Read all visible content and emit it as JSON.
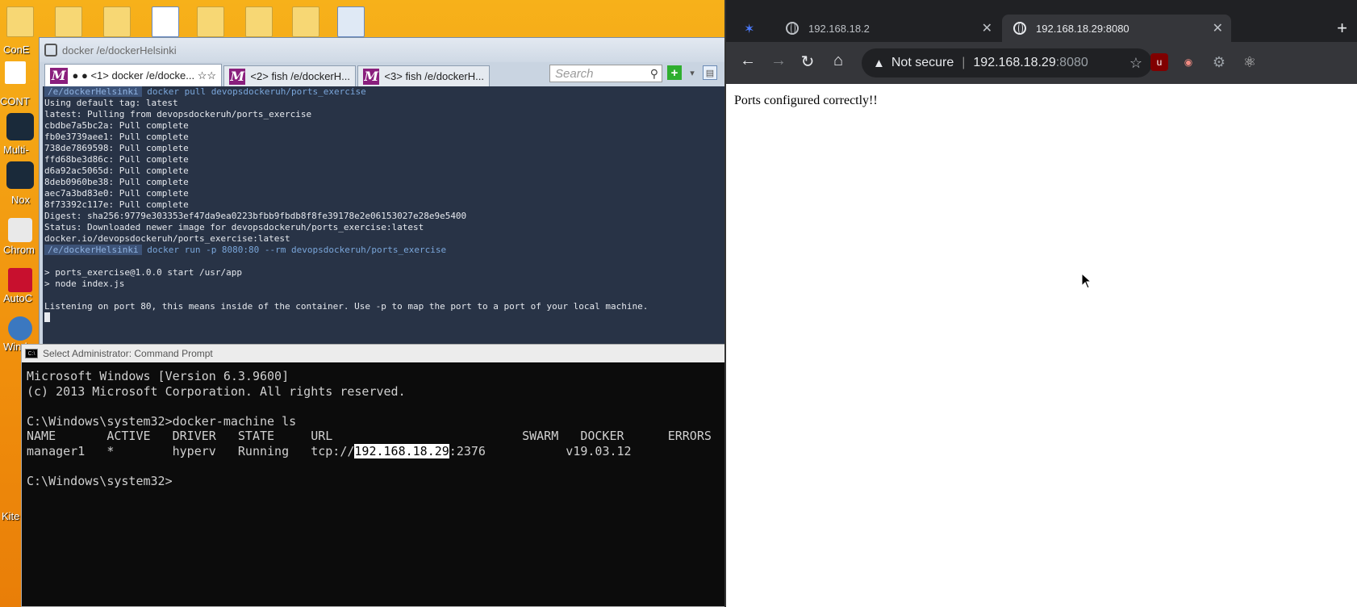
{
  "desktop": {
    "labels": [
      "ConE",
      "CONT",
      "Multi-",
      "Nox",
      "Chrom",
      "AutoC",
      "Windo",
      "Kite"
    ]
  },
  "conemu": {
    "title": "docker /e/dockerHelsinki",
    "tabs": [
      {
        "label": "● ● <1> docker /e/docke... ☆☆"
      },
      {
        "label": "<2> fish /e/dockerH..."
      },
      {
        "label": "<3> fish /e/dockerH..."
      }
    ],
    "search_placeholder": "Search",
    "console": {
      "prompt_path": "/e/dockerHelsinki",
      "cmd1": "docker pull devopsdockeruh/ports_exercise",
      "out1": [
        "Using default tag: latest",
        "latest: Pulling from devopsdockeruh/ports_exercise",
        "cbdbe7a5bc2a: Pull complete",
        "fb0e3739aee1: Pull complete",
        "738de7869598: Pull complete",
        "ffd68be3d86c: Pull complete",
        "d6a92ac5065d: Pull complete",
        "8deb0960be38: Pull complete",
        "aec7a3bd83e0: Pull complete",
        "8f73392c117e: Pull complete",
        "Digest: sha256:9779e303353ef47da9ea0223bfbb9fbdb8f8fe39178e2e06153027e28e9e5400",
        "Status: Downloaded newer image for devopsdockeruh/ports_exercise:latest",
        "docker.io/devopsdockeruh/ports_exercise:latest"
      ],
      "cmd2": "docker run -p 8080:80 --rm devopsdockeruh/ports_exercise",
      "out2": [
        "",
        "> ports_exercise@1.0.0 start /usr/app",
        "> node index.js",
        "",
        "Listening on port 80, this means inside of the container. Use -p to map the port to a port of your local machine."
      ]
    }
  },
  "cmd": {
    "title": "Select Administrator: Command Prompt",
    "lines": [
      "Microsoft Windows [Version 6.3.9600]",
      "(c) 2013 Microsoft Corporation. All rights reserved.",
      "",
      "C:\\Windows\\system32>docker-machine ls",
      "NAME       ACTIVE   DRIVER   STATE     URL                          SWARM   DOCKER      ERRORS"
    ],
    "row_prefix": "manager1   *        hyperv   Running   tcp://",
    "row_ip": "192.168.18.29",
    "row_suffix": ":2376           v19.03.12",
    "final_prompt": "C:\\Windows\\system32>"
  },
  "browser": {
    "tabs": [
      {
        "label": "192.168.18.2"
      },
      {
        "label": "192.168.18.29:8080"
      }
    ],
    "security_label": "Not secure",
    "url_host": "192.168.18.29",
    "url_port": ":8080",
    "page_text": "Ports configured correctly!!"
  }
}
